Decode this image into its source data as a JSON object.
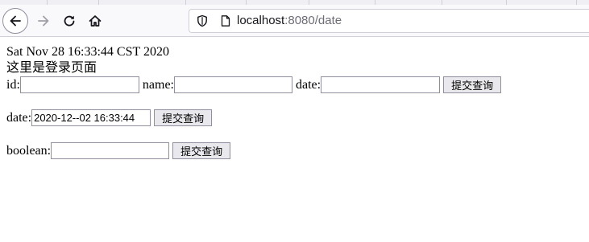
{
  "browser": {
    "url_host": "localhost",
    "url_rest": ":8080/date"
  },
  "page": {
    "date_line": "Sat Nov 28 16:33:44 CST 2020",
    "heading": "这里是登录页面",
    "form1": {
      "id_label": "id:",
      "id_value": "",
      "name_label": "name:",
      "name_value": "",
      "date_label": "date:",
      "date_value": "",
      "submit_label": "提交查询"
    },
    "form2": {
      "date_label": "date:",
      "date_value": "2020-12--02 16:33:44",
      "submit_label": "提交查询"
    },
    "form3": {
      "boolean_label": "boolean:",
      "boolean_value": "",
      "submit_label": "提交查询"
    }
  }
}
